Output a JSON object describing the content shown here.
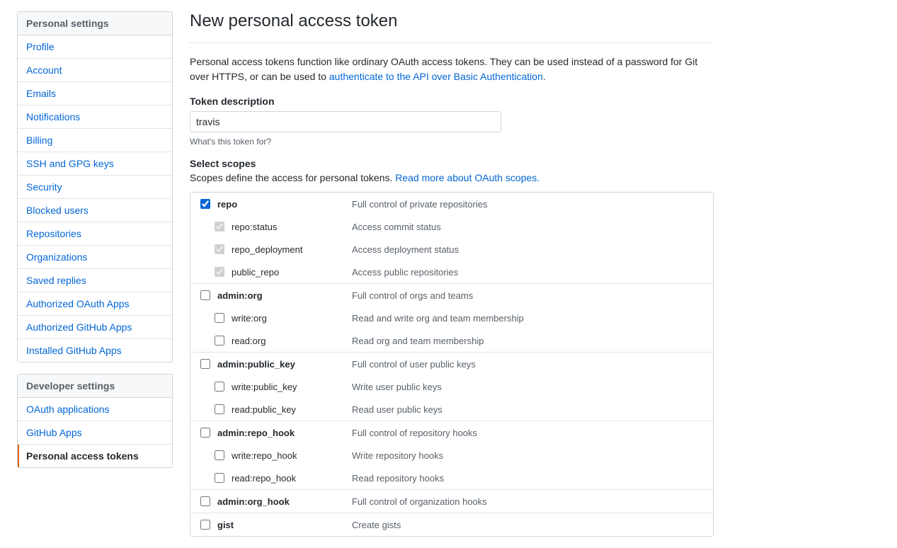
{
  "sidebar": {
    "personal": {
      "header": "Personal settings",
      "items": [
        "Profile",
        "Account",
        "Emails",
        "Notifications",
        "Billing",
        "SSH and GPG keys",
        "Security",
        "Blocked users",
        "Repositories",
        "Organizations",
        "Saved replies",
        "Authorized OAuth Apps",
        "Authorized GitHub Apps",
        "Installed GitHub Apps"
      ]
    },
    "developer": {
      "header": "Developer settings",
      "items": [
        "OAuth applications",
        "GitHub Apps",
        "Personal access tokens"
      ],
      "current_index": 2
    }
  },
  "page": {
    "title": "New personal access token",
    "intro_prefix": "Personal access tokens function like ordinary OAuth access tokens. They can be used instead of a password for Git over HTTPS, or can be used to ",
    "intro_link": "authenticate to the API over Basic Authentication",
    "intro_suffix": ".",
    "token_label": "Token description",
    "token_value": "travis",
    "token_hint": "What's this token for?",
    "scopes_label": "Select scopes",
    "scopes_desc_prefix": "Scopes define the access for personal tokens. ",
    "scopes_desc_link": "Read more about OAuth scopes."
  },
  "scopes": [
    {
      "name": "repo",
      "desc": "Full control of private repositories",
      "checked": true,
      "children": [
        {
          "name": "repo:status",
          "desc": "Access commit status",
          "checked": true,
          "disabled": true
        },
        {
          "name": "repo_deployment",
          "desc": "Access deployment status",
          "checked": true,
          "disabled": true
        },
        {
          "name": "public_repo",
          "desc": "Access public repositories",
          "checked": true,
          "disabled": true
        }
      ]
    },
    {
      "name": "admin:org",
      "desc": "Full control of orgs and teams",
      "checked": false,
      "children": [
        {
          "name": "write:org",
          "desc": "Read and write org and team membership",
          "checked": false
        },
        {
          "name": "read:org",
          "desc": "Read org and team membership",
          "checked": false
        }
      ]
    },
    {
      "name": "admin:public_key",
      "desc": "Full control of user public keys",
      "checked": false,
      "children": [
        {
          "name": "write:public_key",
          "desc": "Write user public keys",
          "checked": false
        },
        {
          "name": "read:public_key",
          "desc": "Read user public keys",
          "checked": false
        }
      ]
    },
    {
      "name": "admin:repo_hook",
      "desc": "Full control of repository hooks",
      "checked": false,
      "children": [
        {
          "name": "write:repo_hook",
          "desc": "Write repository hooks",
          "checked": false
        },
        {
          "name": "read:repo_hook",
          "desc": "Read repository hooks",
          "checked": false
        }
      ]
    },
    {
      "name": "admin:org_hook",
      "desc": "Full control of organization hooks",
      "checked": false,
      "children": []
    },
    {
      "name": "gist",
      "desc": "Create gists",
      "checked": false,
      "children": []
    }
  ]
}
